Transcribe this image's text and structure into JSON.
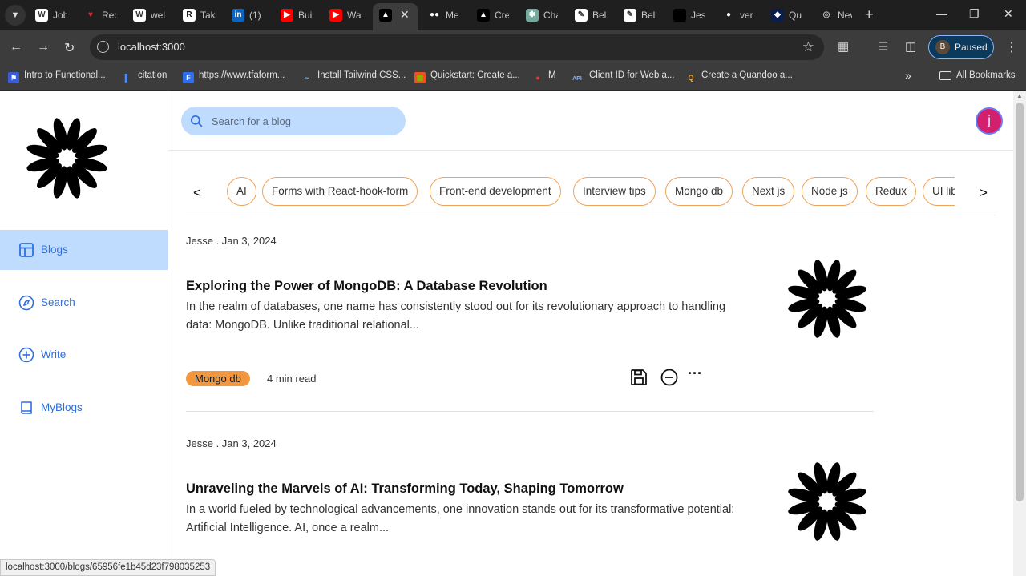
{
  "browser": {
    "tabs": [
      {
        "icon": "W",
        "title": "Job",
        "icon_bg": "#ffffff",
        "icon_fg": "#333"
      },
      {
        "icon": "♥",
        "title": "Rec",
        "icon_bg": "#1f1f1f",
        "icon_fg": "#e0282e"
      },
      {
        "icon": "W",
        "title": "wel",
        "icon_bg": "#ffffff",
        "icon_fg": "#333"
      },
      {
        "icon": "R",
        "title": "Tak",
        "icon_bg": "#ffffff",
        "icon_fg": "#111"
      },
      {
        "icon": "in",
        "title": "(1)",
        "icon_bg": "#0a66c2",
        "icon_fg": "#fff"
      },
      {
        "icon": "▶",
        "title": "Bui",
        "icon_bg": "#ff0000",
        "icon_fg": "#fff"
      },
      {
        "icon": "▶",
        "title": "Wa",
        "icon_bg": "#ff0000",
        "icon_fg": "#fff"
      },
      {
        "icon": "▲",
        "title": "",
        "icon_bg": "#000000",
        "icon_fg": "#fff"
      },
      {
        "icon": "●●",
        "title": "Me",
        "icon_bg": "#1f1f1f",
        "icon_fg": "#fff"
      },
      {
        "icon": "▲",
        "title": "Cre",
        "icon_bg": "#000000",
        "icon_fg": "#fff"
      },
      {
        "icon": "✱",
        "title": "Cha",
        "icon_bg": "#74aa9c",
        "icon_fg": "#fff"
      },
      {
        "icon": "✎",
        "title": "Bel",
        "icon_bg": "#ffffff",
        "icon_fg": "#333"
      },
      {
        "icon": "✎",
        "title": "Bel",
        "icon_bg": "#ffffff",
        "icon_fg": "#333"
      },
      {
        "icon": "",
        "title": "Jes",
        "icon_bg": "#000000",
        "icon_fg": "#fff"
      },
      {
        "icon": "●",
        "title": "ver",
        "icon_bg": "#1f1f1f",
        "icon_fg": "#fff"
      },
      {
        "icon": "◆",
        "title": "Qu",
        "icon_bg": "#0b1d4f",
        "icon_fg": "#fff"
      },
      {
        "icon": "◎",
        "title": "Nev",
        "icon_bg": "#1f1f1f",
        "icon_fg": "#bbb"
      }
    ],
    "url": "localhost:3000",
    "profile_initial": "B",
    "profile_status": "Paused",
    "bookmarks": [
      {
        "icon": "⚑",
        "label": "Intro to Functional...",
        "icon_bg": "#3b5bdb",
        "icon_fg": "#fff"
      },
      {
        "icon": "▌",
        "label": "citation",
        "icon_bg": "#3c3c3c",
        "icon_fg": "#4f8df5"
      },
      {
        "icon": "F",
        "label": "https://www.tfaform...",
        "icon_bg": "#2e6ff2",
        "icon_fg": "#fff"
      },
      {
        "icon": "∼",
        "label": "Install Tailwind CSS...",
        "icon_bg": "#3c3c3c",
        "icon_fg": "#38bdf8"
      },
      {
        "icon": "▦",
        "label": "Quickstart: Create a...",
        "icon_bg": "#f25022",
        "icon_fg": "#7fba00"
      },
      {
        "icon": "●",
        "label": "M",
        "icon_bg": "#3c3c3c",
        "icon_fg": "#e5383b"
      },
      {
        "icon": "API",
        "label": "Client ID for Web a...",
        "icon_bg": "#3c3c3c",
        "icon_fg": "#8ab4f8"
      },
      {
        "icon": "Q",
        "label": "Create a Quandoo a...",
        "icon_bg": "#3c3c3c",
        "icon_fg": "#f5a623"
      }
    ],
    "all_bookmarks": "All Bookmarks",
    "status_url": "localhost:3000/blogs/65956fe1b45d23f798035253"
  },
  "sidebar": {
    "items": [
      {
        "label": "Blogs",
        "icon": "layout-icon",
        "active": true
      },
      {
        "label": "Search",
        "icon": "compass-icon",
        "active": false
      },
      {
        "label": "Write",
        "icon": "plus-circle-icon",
        "active": false
      },
      {
        "label": "MyBlogs",
        "icon": "book-icon",
        "active": false
      }
    ]
  },
  "header": {
    "search_placeholder": "Search for a blog",
    "user_initial": "j"
  },
  "categories": {
    "prev": "<",
    "next": ">",
    "items": [
      "AI",
      "Forms with React-hook-form",
      "Front-end development",
      "Interview tips",
      "Mongo db",
      "Next js",
      "Node js",
      "Redux",
      "UI libraries"
    ]
  },
  "posts": [
    {
      "meta": "Jesse .  Jan 3, 2024",
      "title": "Exploring the Power of MongoDB: A Database Revolution",
      "excerpt": "In the realm of databases, one name has consistently stood out for its revolutionary approach to handling data: MongoDB. Unlike traditional relational...",
      "tag": "Mongo db",
      "read_time": "4 min read",
      "more": "···"
    },
    {
      "meta": "Jesse .  Jan 3, 2024",
      "title": "Unraveling the Marvels of AI: Transforming Today, Shaping Tomorrow",
      "excerpt": "In a world fueled by technological advancements, one innovation stands out for its transformative potential: Artificial Intelligence. AI, once a realm..."
    }
  ],
  "colors": {
    "accent_blue": "#2f6fde",
    "active_bg": "#bfdcff",
    "chip_border": "#f0a35a",
    "tag_bg": "#f2973e",
    "avatar_bg": "#d3206e"
  }
}
